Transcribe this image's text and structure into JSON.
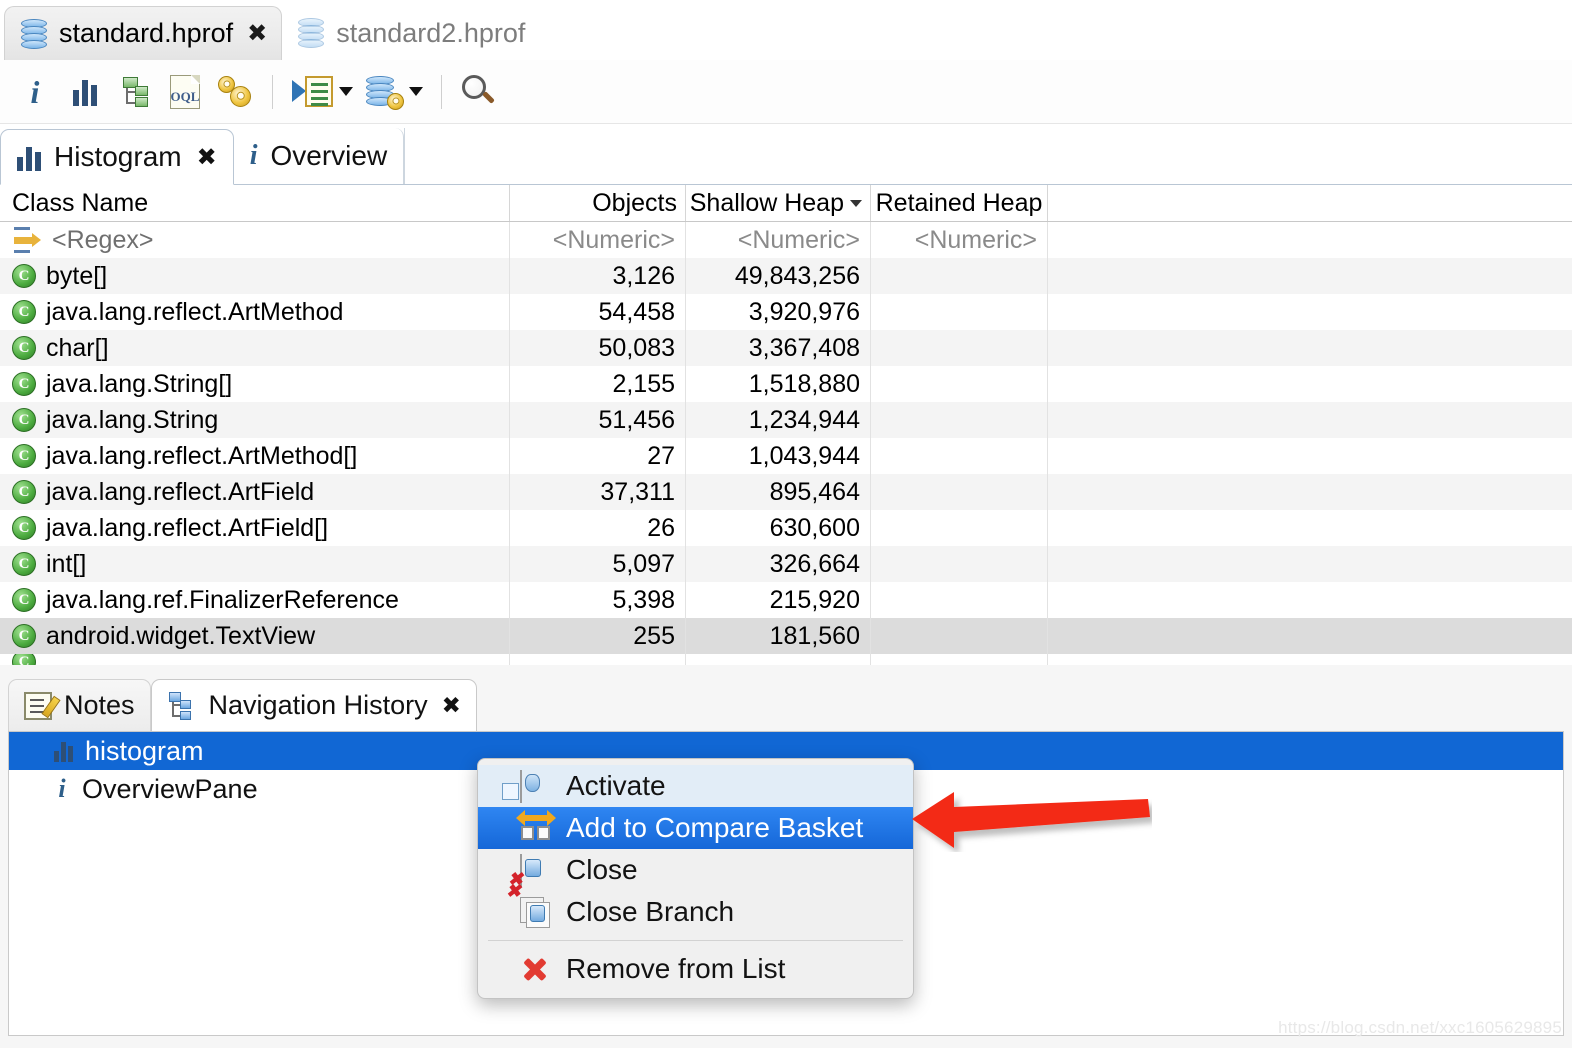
{
  "editor_tabs": [
    {
      "label": "standard.hprof",
      "icon": "heap-dump-icon",
      "active": true,
      "closable": true,
      "close_glyph": "✖"
    },
    {
      "label": "standard2.hprof",
      "icon": "heap-dump-icon",
      "active": false,
      "closable": false,
      "close_glyph": ""
    }
  ],
  "toolbar": {
    "buttons": [
      {
        "name": "overview-info-button",
        "icon": "info-icon",
        "glyph": "i"
      },
      {
        "name": "histogram-button",
        "icon": "histogram-bars-icon",
        "glyph": ""
      },
      {
        "name": "dominator-tree-button",
        "icon": "tree-icon",
        "glyph": ""
      },
      {
        "name": "oql-button",
        "icon": "oql-document-icon",
        "glyph": "OQL"
      },
      {
        "name": "calculate-retained-size-button",
        "icon": "gears-icon",
        "glyph": ""
      },
      {
        "name": "run-expert-system-test-button",
        "icon": "run-query-icon",
        "glyph": "",
        "has_caret": true
      },
      {
        "name": "heap-dump-actions-button",
        "icon": "database-gear-icon",
        "glyph": "",
        "has_caret": true
      },
      {
        "name": "find-button",
        "icon": "search-icon",
        "glyph": ""
      }
    ]
  },
  "view_tabs": [
    {
      "label": "Histogram",
      "icon": "histogram-bars-icon",
      "active": true,
      "close_glyph": "✖"
    },
    {
      "label": "Overview",
      "icon": "info-icon",
      "active": false,
      "close_glyph": ""
    }
  ],
  "table": {
    "columns": [
      "Class Name",
      "Objects",
      "Shallow Heap",
      "Retained Heap"
    ],
    "sorted_column": "Shallow Heap",
    "sort_direction": "desc",
    "filter_row": {
      "class_name": "<Regex>",
      "objects": "<Numeric>",
      "shallow": "<Numeric>",
      "retained": "<Numeric>"
    },
    "rows": [
      {
        "class_name": "byte[]",
        "objects": "3,126",
        "shallow": "49,843,256",
        "retained": ""
      },
      {
        "class_name": "java.lang.reflect.ArtMethod",
        "objects": "54,458",
        "shallow": "3,920,976",
        "retained": ""
      },
      {
        "class_name": "char[]",
        "objects": "50,083",
        "shallow": "3,367,408",
        "retained": ""
      },
      {
        "class_name": "java.lang.String[]",
        "objects": "2,155",
        "shallow": "1,518,880",
        "retained": ""
      },
      {
        "class_name": "java.lang.String",
        "objects": "51,456",
        "shallow": "1,234,944",
        "retained": ""
      },
      {
        "class_name": "java.lang.reflect.ArtMethod[]",
        "objects": "27",
        "shallow": "1,043,944",
        "retained": ""
      },
      {
        "class_name": "java.lang.reflect.ArtField",
        "objects": "37,311",
        "shallow": "895,464",
        "retained": ""
      },
      {
        "class_name": "java.lang.reflect.ArtField[]",
        "objects": "26",
        "shallow": "630,600",
        "retained": ""
      },
      {
        "class_name": "int[]",
        "objects": "5,097",
        "shallow": "326,664",
        "retained": ""
      },
      {
        "class_name": "java.lang.ref.FinalizerReference",
        "objects": "5,398",
        "shallow": "215,920",
        "retained": ""
      },
      {
        "class_name": "android.widget.TextView",
        "objects": "255",
        "shallow": "181,560",
        "retained": ""
      }
    ]
  },
  "bottom_panel": {
    "tabs": [
      {
        "label": "Notes",
        "icon": "notes-icon",
        "active": false,
        "close_glyph": ""
      },
      {
        "label": "Navigation History",
        "icon": "navigation-history-icon",
        "active": true,
        "close_glyph": "✖"
      }
    ],
    "items": [
      {
        "label": "histogram",
        "icon": "histogram-bars-icon",
        "selected": true
      },
      {
        "label": "OverviewPane",
        "icon": "info-icon",
        "selected": false
      }
    ]
  },
  "context_menu": {
    "items": [
      {
        "label": "Activate",
        "icon": "activate-icon",
        "state": "hover"
      },
      {
        "label": "Add to Compare Basket",
        "icon": "compare-basket-icon",
        "state": "selected"
      },
      {
        "label": "Close",
        "icon": "close-dump-icon",
        "state": "normal"
      },
      {
        "label": "Close Branch",
        "icon": "close-branch-icon",
        "state": "normal"
      },
      {
        "label": "Remove from List",
        "icon": "red-x-icon",
        "state": "normal",
        "after_separator": true
      }
    ]
  },
  "annotation": {
    "arrow": "left-pointing-red-arrow",
    "color": "#f32b18"
  },
  "watermark": {
    "text": "https://blog.csdn.net/xxc1605629895"
  },
  "colors": {
    "selection_blue": "#1167d4",
    "menu_selected_blue": "#1f78e8",
    "class_icon_green": "#4cab3f",
    "annotation_red": "#f32b18"
  }
}
